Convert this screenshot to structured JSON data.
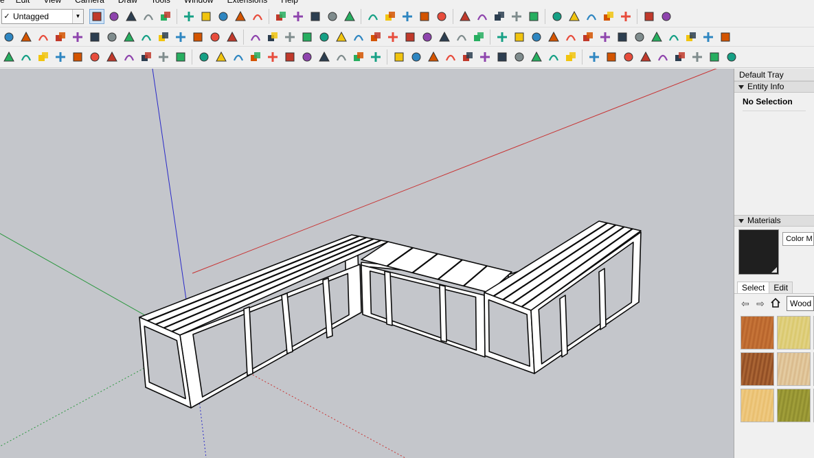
{
  "menu": [
    "e",
    "Edit",
    "View",
    "Camera",
    "Draw",
    "Tools",
    "Window",
    "Extensions",
    "Help"
  ],
  "tag_dropdown": {
    "check": "✓",
    "value": "Untagged"
  },
  "tray": {
    "title": "Default Tray",
    "entity_info": {
      "header": "Entity Info",
      "status": "No Selection"
    },
    "materials": {
      "header": "Materials",
      "current_color": "#1f1f1f",
      "color_name": "Color M",
      "tabs": [
        "Select",
        "Edit"
      ],
      "library": "Wood",
      "swatches": [
        {
          "colors": [
            "#b5622a",
            "#c9773a"
          ]
        },
        {
          "colors": [
            "#d9c76a",
            "#e3d48a"
          ]
        },
        {
          "colors": [
            "#e8e0cc",
            "#ece6d6"
          ]
        },
        {
          "colors": [
            "#8c4a22",
            "#b06a38"
          ]
        },
        {
          "colors": [
            "#d8b889",
            "#e6cfa6"
          ]
        },
        {
          "colors": [
            "#d8d2c2",
            "#e4dfd2"
          ]
        },
        {
          "colors": [
            "#e8bd6c",
            "#f0cc86"
          ]
        },
        {
          "colors": [
            "#8c8a2c",
            "#a4a23c"
          ]
        },
        {
          "colors": [
            "#e2dccb",
            "#ece7da"
          ]
        }
      ]
    }
  },
  "colors": {
    "viewport_bg": "#c4c6cb",
    "axis_red": "#c83232",
    "axis_green": "#28963c",
    "axis_blue": "#2828c8",
    "model_line": "#0a0a0a",
    "model_face": "#ffffff"
  },
  "toolbar_icons": {
    "row1": [
      "select-icon",
      "eraser-icon",
      "pencil-icon",
      "arc-icon",
      "rectangle-icon",
      "push-pull-icon",
      "follow-me-icon",
      "move-icon",
      "rotate-icon",
      "scale-icon",
      "tape-measure-icon",
      "text-icon",
      "paint-bucket-icon",
      "orbit-icon",
      "pan-icon",
      "zoom-icon",
      "zoom-extents-icon",
      "sandbox-icon",
      "warehouse-icon",
      "extension-warehouse-icon",
      "section-icon",
      "user-icon",
      "view-iso-icon",
      "view-top-icon",
      "view-front-icon",
      "view-right-icon",
      "view-back-icon",
      "style-xray-icon",
      "style-wire-icon",
      "style-shaded-icon",
      "solid-tools-icon",
      "outer-shell-icon"
    ],
    "row2": [
      "tool-a-icon",
      "tool-b-icon",
      "tool-c-icon",
      "tool-d-icon",
      "tool-e-icon",
      "tool-f-icon",
      "tool-g-icon",
      "tool-h-icon",
      "tool-i-icon",
      "tool-j-icon",
      "tool-k-icon",
      "tool-l-icon",
      "tool-m-icon",
      "tool-n-icon",
      "tool-o-icon",
      "tool-p-icon",
      "tool-q-icon",
      "tool-r-icon",
      "tool-s-icon",
      "tool-t-icon",
      "tool-u-icon",
      "tool-v-icon",
      "tool-w-icon",
      "tool-x-icon",
      "tool-y-icon",
      "tool-z-icon",
      "tool-aa-icon",
      "tool-ab-icon",
      "tool-ac-icon",
      "tool-ad-icon",
      "tool-ae-icon",
      "tool-af-icon",
      "tool-ag-icon",
      "tool-ah-icon",
      "tool-ai-icon",
      "tool-aj-icon",
      "tool-ak-icon",
      "tool-al-icon",
      "tool-am-icon",
      "tool-an-icon",
      "tool-ao-icon",
      "tool-ap-icon"
    ],
    "row3": [
      "layer-icon",
      "refresh-icon",
      "camera-icon",
      "plus-circle-icon",
      "tree-icon",
      "hatch-icon",
      "checker-icon",
      "cloud-icon",
      "gear-icon",
      "mail-icon",
      "info-icon",
      "curve-a-icon",
      "curve-b-icon",
      "curve-c-icon",
      "curve-d-icon",
      "curve-e-icon",
      "curve-f-icon",
      "curve-g-icon",
      "curve-h-icon",
      "curve-i-icon",
      "curve-j-icon",
      "curve-k-icon",
      "curve-l-icon",
      "curve-m-icon",
      "curve-n-icon",
      "curve-o-icon",
      "curve-p-icon",
      "curve-q-icon",
      "curve-r-icon",
      "curve-s-icon",
      "curve-t-icon",
      "curve-u-icon",
      "curve-v-icon",
      "curve-w-icon",
      "curve-x-icon",
      "curve-y-icon",
      "curve-z-icon",
      "curve-aa-icon",
      "curve-ab-icon",
      "curve-ac-icon",
      "curve-ad-icon",
      "curve-ae-icon"
    ]
  }
}
